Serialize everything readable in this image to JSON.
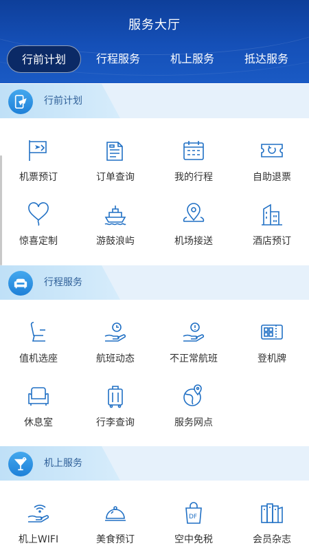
{
  "header": {
    "title": "服务大厅"
  },
  "tabs": [
    {
      "label": "行前计划",
      "active": true
    },
    {
      "label": "行程服务",
      "active": false
    },
    {
      "label": "机上服务",
      "active": false
    },
    {
      "label": "抵达服务",
      "active": false
    }
  ],
  "colors": {
    "header_bg": "#1550b8",
    "active_tab_bg": "#0b2a66",
    "icon_blue": "#1f6fc4",
    "section_bg": "#e6f1fb"
  },
  "sections": [
    {
      "label": "行前计划",
      "icon": "airplane-phone-icon",
      "items": [
        {
          "label": "机票预订",
          "icon": "flight-ticket-icon"
        },
        {
          "label": "订单查询",
          "icon": "order-document-icon"
        },
        {
          "label": "我的行程",
          "icon": "calendar-icon"
        },
        {
          "label": "自助退票",
          "icon": "ticket-refund-icon"
        },
        {
          "label": "惊喜定制",
          "icon": "heart-balloon-icon"
        },
        {
          "label": "游鼓浪屿",
          "icon": "ship-icon"
        },
        {
          "label": "机场接送",
          "icon": "location-pin-icon"
        },
        {
          "label": "酒店预订",
          "icon": "hotel-building-icon"
        }
      ]
    },
    {
      "label": "行程服务",
      "icon": "sofa-icon",
      "items": [
        {
          "label": "值机选座",
          "icon": "seat-icon"
        },
        {
          "label": "航班动态",
          "icon": "clock-hand-icon"
        },
        {
          "label": "不正常航班",
          "icon": "alert-hand-icon"
        },
        {
          "label": "登机牌",
          "icon": "boarding-pass-icon"
        },
        {
          "label": "休息室",
          "icon": "lounge-sofa-icon"
        },
        {
          "label": "行李查询",
          "icon": "luggage-icon"
        },
        {
          "label": "服务网点",
          "icon": "globe-pin-icon"
        }
      ]
    },
    {
      "label": "机上服务",
      "icon": "cocktail-icon",
      "items": [
        {
          "label": "机上WIFI",
          "icon": "wifi-hand-icon"
        },
        {
          "label": "美食预订",
          "icon": "food-cloche-icon"
        },
        {
          "label": "空中免税",
          "icon": "duty-free-bag-icon"
        },
        {
          "label": "会员杂志",
          "icon": "magazine-icon"
        }
      ]
    }
  ]
}
